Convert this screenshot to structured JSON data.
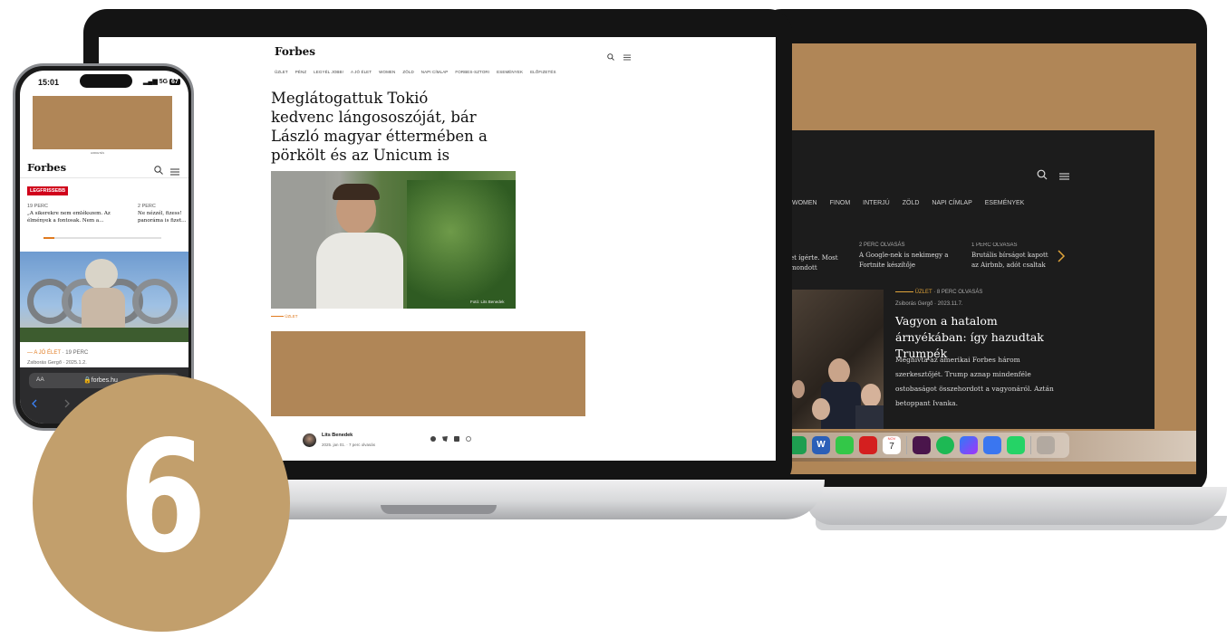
{
  "front": {
    "logo": "Forbes",
    "nav": [
      "ÜZLET",
      "PÉNZ",
      "LEGYÉL JOBB!",
      "A JÓ ÉLET",
      "WOMEN",
      "ZÖLD",
      "NAPI CÍMLAP",
      "FORBES-SZTORI",
      "ESEMÉNYEK",
      "ELŐFIZETÉS"
    ],
    "headline": "Meglátogattuk Tokió kedvenc lángososzóját, bár László magyar éttermében a pörkölt és az Unicum is nagyon megy",
    "photo_credit": "Fotó: Lits Benedek",
    "category": "ÜZLET",
    "author": {
      "name": "Lits Benedek",
      "meta": "2025. jan 01. · 7 perc olvasás"
    }
  },
  "back": {
    "nav": [
      "WOMEN",
      "FINOM",
      "INTERJÚ",
      "ZÖLD",
      "NAPI CÍMLAP",
      "ESEMÉNYEK"
    ],
    "ticker": [
      {
        "meta": "",
        "title": "et ígérte. Most mondott"
      },
      {
        "meta": "2 PERC OLVASÁS",
        "title": "A Google-nek is nekimegy a Fortnite készítője"
      },
      {
        "meta": "1 PERC OLVASÁS",
        "title": "Brutális bírságot kapott az Airbnb, adót csaltak a…"
      }
    ],
    "feature": {
      "category": "ÜZLET",
      "readtime": "8 PERC OLVASÁS",
      "byline": "Zsiborás Gergő · 2023.11.7.",
      "title": "Vagyon a hatalom árnyékában: így hazudtak Trumpék",
      "summary": "Meghívta az amerikai Forbes három szerkesztőjét. Trump aznap mindenféle ostobaságot összehordott a vagyonáról. Aztán betoppant Ivanka."
    },
    "calendar_day": "7",
    "calendar_month": "NOV"
  },
  "phone": {
    "time": "15:01",
    "signal": "5G",
    "battery": "67",
    "ad_label": "HIRDETÉS",
    "logo": "Forbes",
    "badge": "LEGFRISSEBB",
    "news": [
      {
        "meta": "19 PERC",
        "title": "„A sikerekre nem emlékszem. Az élmények a fontosak. Nem a…"
      },
      {
        "meta": "2 PERC",
        "title": "Ne nézzél, fizess! panoráma is fizet…"
      }
    ],
    "article_category": "A JÓ ÉLET",
    "article_readtime": "19 PERC",
    "article_byline": "Zsiborás Gergő · 2025.1.2.",
    "address_aa": "AA",
    "address_url": "forbes.hu"
  },
  "badge_number": "6",
  "colors": {
    "accent": "#e07a1f",
    "ad": "#b08657",
    "badge": "#c29f6c",
    "phone_tag": "#d0021b"
  }
}
